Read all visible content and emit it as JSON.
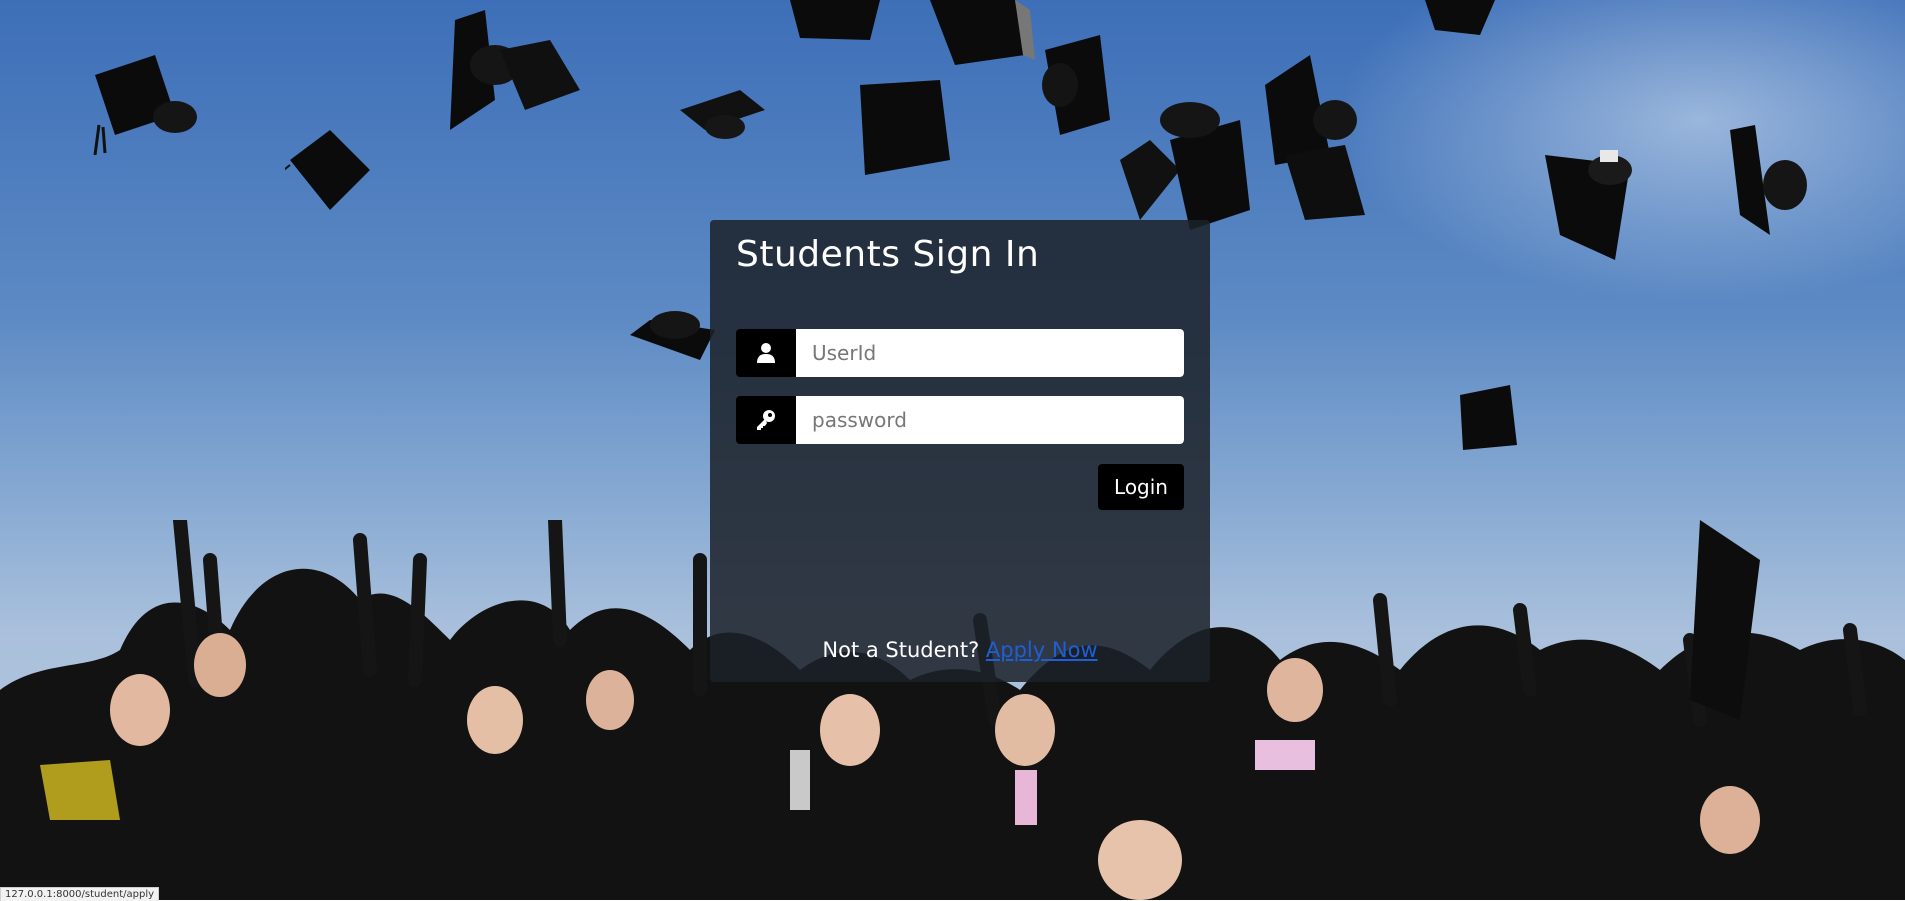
{
  "login": {
    "title": "Students Sign In",
    "userid_placeholder": "UserId",
    "password_placeholder": "password",
    "login_label": "Login",
    "not_student_text": "Not a Student? ",
    "apply_link_text": "Apply Now"
  },
  "status_bar": {
    "url": "127.0.0.1:8000/student/apply"
  },
  "icons": {
    "user": "user-icon",
    "key": "key-icon"
  },
  "colors": {
    "panel": "#1c222a",
    "addon": "#000000",
    "button": "#000000",
    "link": "#1f5fd6"
  }
}
